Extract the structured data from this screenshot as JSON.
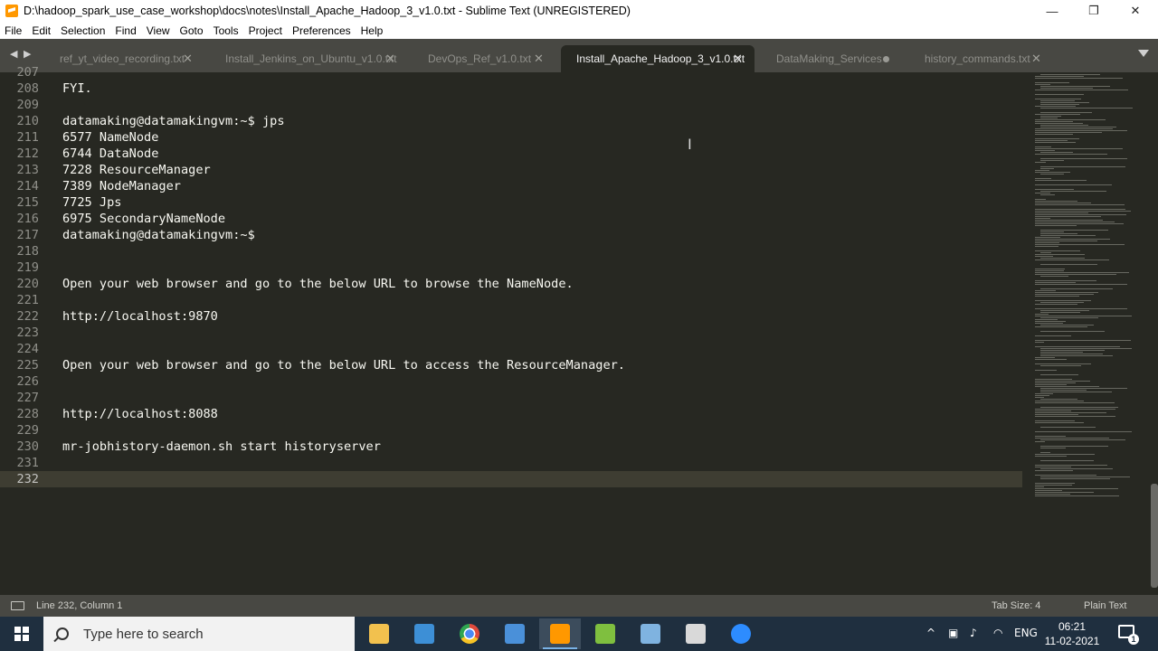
{
  "window": {
    "title": "D:\\hadoop_spark_use_case_workshop\\docs\\notes\\Install_Apache_Hadoop_3_v1.0.txt - Sublime Text (UNREGISTERED)",
    "minimize": "—",
    "maximize": "❐",
    "close": "✕"
  },
  "menu": [
    "File",
    "Edit",
    "Selection",
    "Find",
    "View",
    "Goto",
    "Tools",
    "Project",
    "Preferences",
    "Help"
  ],
  "tabs": [
    {
      "label": "ref_yt_video_recording.txt",
      "close": "✕",
      "active": false,
      "dirty": false
    },
    {
      "label": "Install_Jenkins_on_Ubuntu_v1.0.txt",
      "close": "✕",
      "active": false,
      "dirty": false
    },
    {
      "label": "DevOps_Ref_v1.0.txt",
      "close": "✕",
      "active": false,
      "dirty": false
    },
    {
      "label": "Install_Apache_Hadoop_3_v1.0.txt",
      "close": "✕",
      "active": true,
      "dirty": false
    },
    {
      "label": "DataMaking_Services",
      "close": "",
      "active": false,
      "dirty": true
    },
    {
      "label": "history_commands.txt",
      "close": "✕",
      "active": false,
      "dirty": false
    }
  ],
  "tabnav": {
    "left": "◀",
    "right": "▶"
  },
  "editor": {
    "current_line": 232,
    "lines": [
      {
        "n": "207",
        "text": ""
      },
      {
        "n": "208",
        "text": "FYI."
      },
      {
        "n": "209",
        "text": ""
      },
      {
        "n": "210",
        "text": "datamaking@datamakingvm:~$ jps"
      },
      {
        "n": "211",
        "text": "6577 NameNode"
      },
      {
        "n": "212",
        "text": "6744 DataNode"
      },
      {
        "n": "213",
        "text": "7228 ResourceManager"
      },
      {
        "n": "214",
        "text": "7389 NodeManager"
      },
      {
        "n": "215",
        "text": "7725 Jps"
      },
      {
        "n": "216",
        "text": "6975 SecondaryNameNode"
      },
      {
        "n": "217",
        "text": "datamaking@datamakingvm:~$"
      },
      {
        "n": "218",
        "text": ""
      },
      {
        "n": "219",
        "text": ""
      },
      {
        "n": "220",
        "text": "Open your web browser and go to the below URL to browse the NameNode."
      },
      {
        "n": "221",
        "text": ""
      },
      {
        "n": "222",
        "text": "http://localhost:9870"
      },
      {
        "n": "223",
        "text": ""
      },
      {
        "n": "224",
        "text": ""
      },
      {
        "n": "225",
        "text": "Open your web browser and go to the below URL to access the ResourceManager."
      },
      {
        "n": "226",
        "text": ""
      },
      {
        "n": "227",
        "text": ""
      },
      {
        "n": "228",
        "text": "http://localhost:8088"
      },
      {
        "n": "229",
        "text": ""
      },
      {
        "n": "230",
        "text": "mr-jobhistory-daemon.sh start historyserver"
      },
      {
        "n": "231",
        "text": ""
      },
      {
        "n": "232",
        "text": ""
      }
    ]
  },
  "status": {
    "position": "Line 232, Column 1",
    "tab_size": "Tab Size: 4",
    "syntax": "Plain Text"
  },
  "taskbar": {
    "search_placeholder": "Type here to search",
    "apps": [
      {
        "icon": "file-explorer-icon",
        "color": "#f2c14e",
        "active": false
      },
      {
        "icon": "task-view-icon",
        "color": "#3d8fd6",
        "active": false
      },
      {
        "icon": "chrome-icon",
        "color": "#e04a3c",
        "active": false
      },
      {
        "icon": "remote-desktop-icon",
        "color": "#4a90d9",
        "active": false
      },
      {
        "icon": "sublime-text-icon",
        "color": "#ff9800",
        "active": true
      },
      {
        "icon": "notepad-plus-plus-icon",
        "color": "#7fbf3f",
        "active": false
      },
      {
        "icon": "virtualbox-icon",
        "color": "#7fb3e0",
        "active": false
      },
      {
        "icon": "screen-recorder-icon",
        "color": "#d9d9d9",
        "active": false
      },
      {
        "icon": "zoom-icon",
        "color": "#2d8cff",
        "active": false
      }
    ],
    "tray": {
      "chevron": "^",
      "language": "ENG",
      "time": "06:21",
      "date": "11-02-2021",
      "notifications": "1"
    }
  }
}
